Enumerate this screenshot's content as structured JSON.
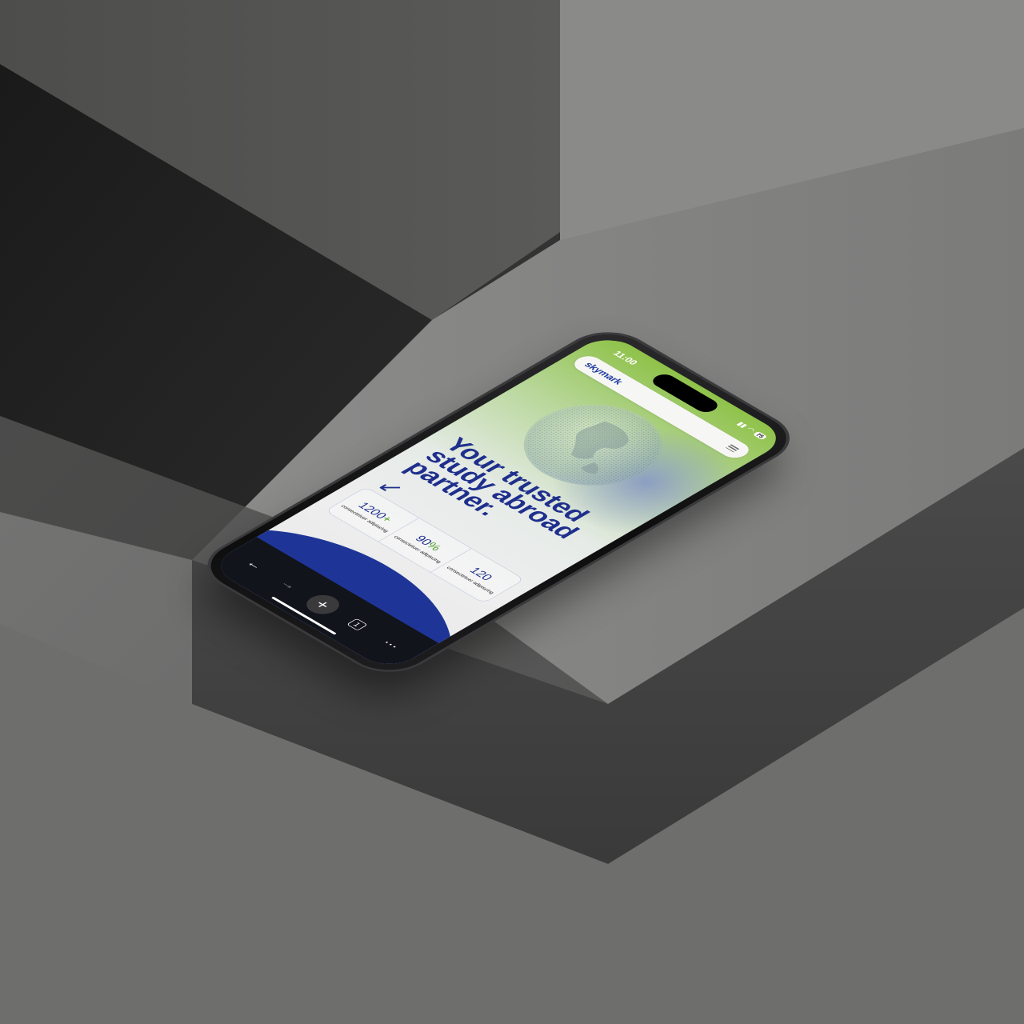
{
  "status_bar": {
    "time": "11:00",
    "battery": "75"
  },
  "browser": {
    "logo_text": "skymark",
    "menu_icon": "hamburger-icon"
  },
  "hero": {
    "headline": "Your trusted study abroad partner.",
    "arrow_icon": "arrow-down-left-icon"
  },
  "stats": [
    {
      "value": "1200",
      "suffix": "+",
      "label": "consectetuer adipiscing"
    },
    {
      "value": "90",
      "suffix": "%",
      "label": "consectetuer adipiscing"
    },
    {
      "value": "120",
      "suffix": "",
      "label": "consectetuer adipiscing"
    }
  ],
  "toolbar": {
    "back_icon": "arrow-left-icon",
    "forward_icon": "arrow-right-icon",
    "new_tab_icon": "plus-icon",
    "tabs_count": "1",
    "more_icon": "more-dots-icon"
  },
  "colors": {
    "brand_blue": "#1e3597",
    "brand_green": "#8fc24a",
    "concrete": "#6a6a6a"
  }
}
